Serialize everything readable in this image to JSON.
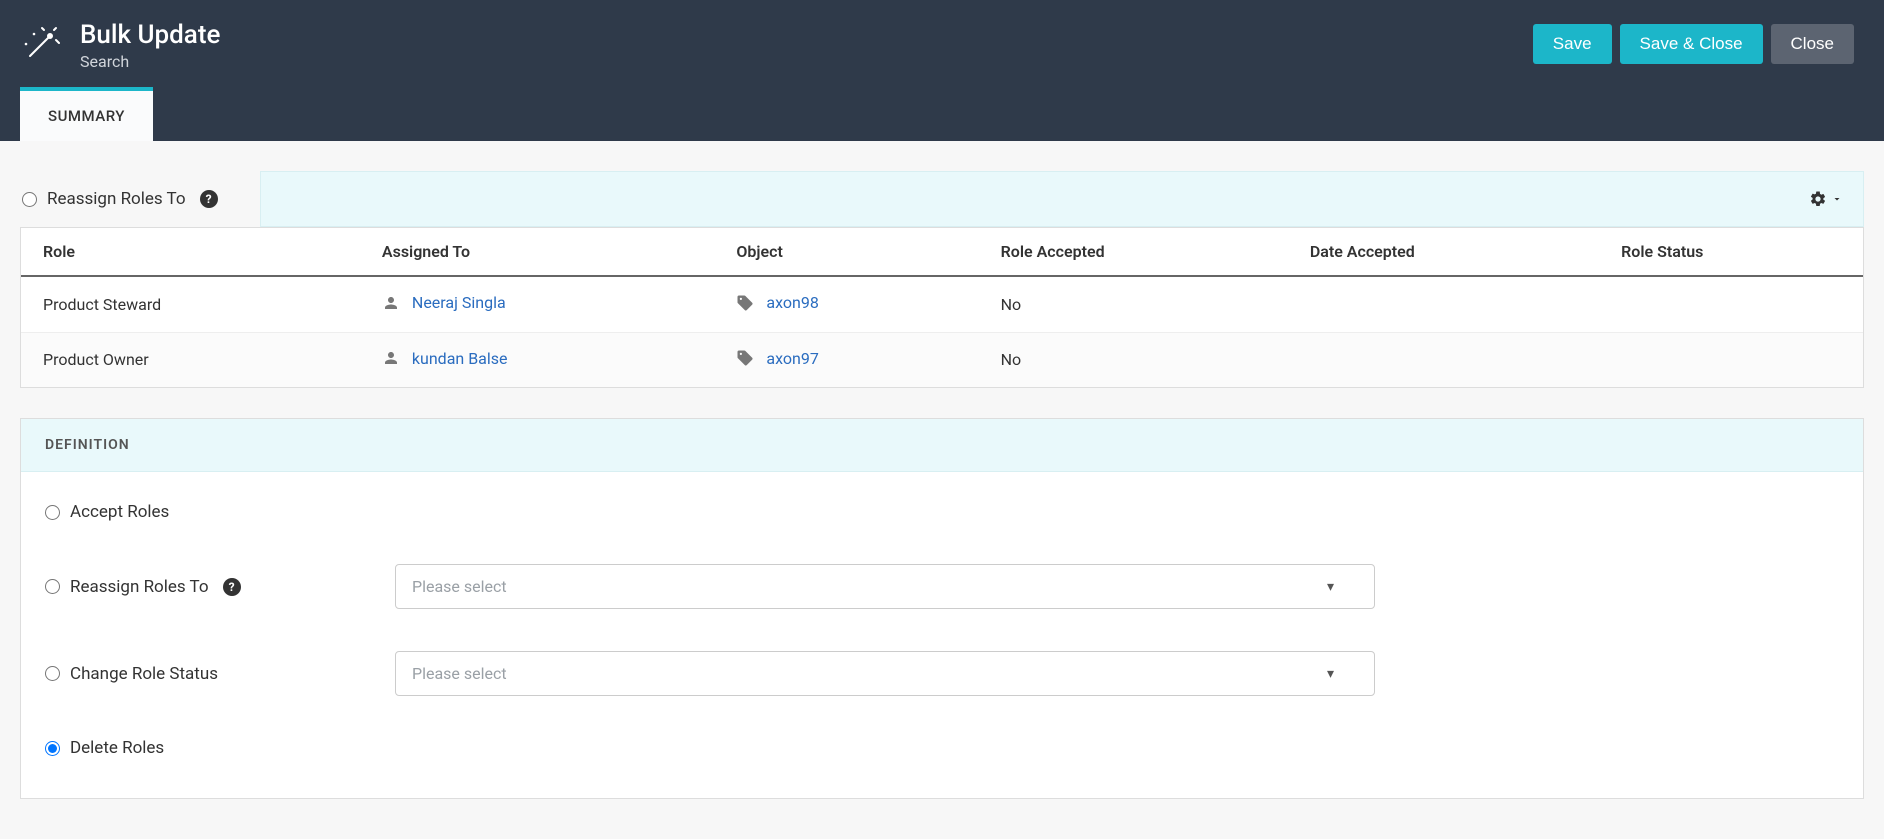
{
  "header": {
    "title": "Bulk Update",
    "subtitle": "Search",
    "buttons": {
      "save": "Save",
      "save_close": "Save & Close",
      "close": "Close"
    }
  },
  "tabs": {
    "summary": "SUMMARY"
  },
  "top_option": {
    "label": "Reassign Roles To"
  },
  "table": {
    "headers": {
      "role": "Role",
      "assigned_to": "Assigned To",
      "object": "Object",
      "role_accepted": "Role Accepted",
      "date_accepted": "Date Accepted",
      "role_status": "Role Status"
    },
    "rows": [
      {
        "role": "Product Steward",
        "assigned_to": "Neeraj Singla",
        "object": "axon98",
        "role_accepted": "No",
        "date_accepted": "",
        "role_status": ""
      },
      {
        "role": "Product Owner",
        "assigned_to": "kundan Balse",
        "object": "axon97",
        "role_accepted": "No",
        "date_accepted": "",
        "role_status": ""
      }
    ]
  },
  "definition": {
    "header": "DEFINITION",
    "options": {
      "accept": "Accept Roles",
      "reassign": "Reassign Roles To",
      "change_status": "Change Role Status",
      "delete": "Delete Roles"
    },
    "selects": {
      "reassign_placeholder": "Please select",
      "status_placeholder": "Please select"
    }
  }
}
